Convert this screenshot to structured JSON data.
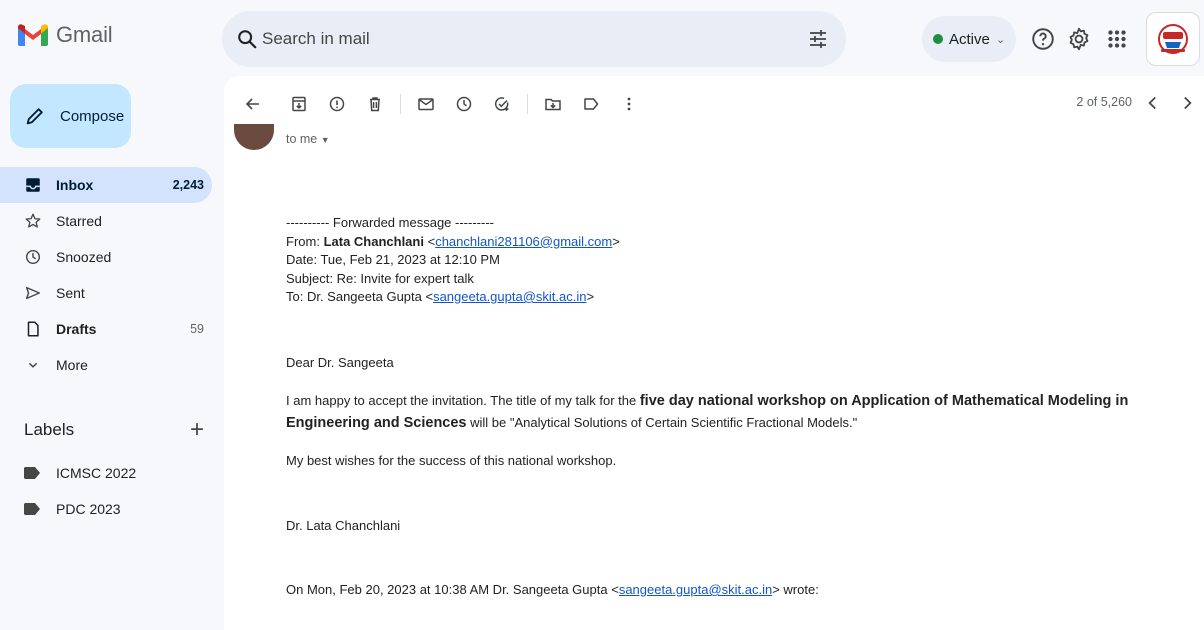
{
  "app": {
    "name": "Gmail"
  },
  "search": {
    "placeholder": "Search in mail"
  },
  "status": {
    "label": "Active",
    "color": "#1e8e3e"
  },
  "sidebar": {
    "compose_label": "Compose",
    "items": [
      {
        "label": "Inbox",
        "count": "2,243",
        "icon": "inbox-icon"
      },
      {
        "label": "Starred",
        "count": "",
        "icon": "star-icon"
      },
      {
        "label": "Snoozed",
        "count": "",
        "icon": "clock-icon"
      },
      {
        "label": "Sent",
        "count": "",
        "icon": "send-icon"
      },
      {
        "label": "Drafts",
        "count": "59",
        "icon": "draft-icon"
      },
      {
        "label": "More",
        "count": "",
        "icon": "chevron-down-icon"
      }
    ],
    "labels_heading": "Labels",
    "labels": [
      {
        "label": "ICMSC 2022"
      },
      {
        "label": "PDC 2023"
      }
    ]
  },
  "toolbar": {
    "pager": "2 of 5,260"
  },
  "email": {
    "recipient_line": "to me",
    "forward_header": "---------- Forwarded message ---------",
    "from_prefix": "From: ",
    "from_name": "Lata Chanchlani",
    "from_email": "chanchlani281106@gmail.com",
    "date": "Date: Tue, Feb 21, 2023 at 12:10 PM",
    "subject": "Subject: Re: Invite for expert talk",
    "to_prefix": "To: Dr. Sangeeta Gupta <",
    "to_email": "sangeeta.gupta@skit.ac.in",
    "greeting": "Dear Dr. Sangeeta",
    "para1_start": "I am happy to accept the invitation. The title of my talk for the ",
    "para1_bold": "five day national workshop on Application of Mathematical Modeling in Engineering and Sciences",
    "para1_end": " will be \"Analytical Solutions of Certain Scientific Fractional Models.\"",
    "para2": "My best wishes for the success of this national workshop.",
    "signature": "Dr. Lata Chanchlani",
    "quote_prefix": "On Mon, Feb 20, 2023 at 10:38 AM Dr. Sangeeta Gupta <",
    "quote_email": "sangeeta.gupta@skit.ac.in",
    "quote_suffix": "> wrote:"
  }
}
